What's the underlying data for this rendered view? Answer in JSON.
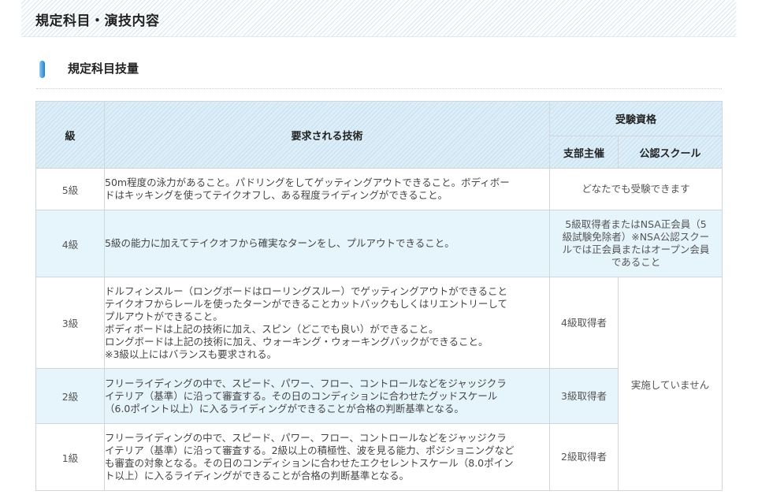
{
  "header": {
    "title": "規定科目・演技内容"
  },
  "section": {
    "title": "規定科目技量"
  },
  "table": {
    "headers": {
      "grade": "級",
      "technique": "要求される技術",
      "qualification": "受験資格",
      "branch": "支部主催",
      "school": "公認スクール"
    },
    "rows": [
      {
        "grade": "5級",
        "tech": [
          "50m程度の泳力があること。パドリングをしてゲッティングアウトできること。ボディボー",
          "ドはキッキングを使ってテイクオフし、ある程度ライディングができること。"
        ],
        "qualification": [
          "どなたでも受験できます"
        ]
      },
      {
        "grade": "4級",
        "tech": [
          "5級の能力に加えてテイクオフから確実なターンをし、プルアウトできること。"
        ],
        "qualification": [
          "5級取得者またはNSA正会員（5",
          "級試験免除者）※NSA公認スクー",
          "ルでは正会員またはオープン会員",
          "であること"
        ]
      },
      {
        "grade": "3級",
        "tech": [
          "ドルフィンスルー（ロングボードはローリングスルー）でゲッティングアウトができること",
          "テイクオフからレールを使ったターンができることカットバックもしくはリエントリーして",
          "プルアウトができること。",
          "ボディボードは上記の技術に加え、スピン（どこでも良い）ができること。",
          "ロングボードは上記の技術に加え、ウォーキング・ウォーキングバックができること。",
          "※3級以上にはバランスも要求される。"
        ],
        "branch": "4級取得者"
      },
      {
        "grade": "2級",
        "tech": [
          "フリーライディングの中で、スピード、パワー、フロー、コントロールなどをジャッジクラ",
          "イテリア（基準）に沿って審査する。その日のコンディションに合わせたグッドスケール",
          "（6.0ポイント以上）に入るライディングができることが合格の判断基準となる。"
        ],
        "branch": "3級取得者"
      },
      {
        "grade": "1級",
        "tech": [
          "フリーライディングの中で、スピード、パワー、フロー、コントロールなどをジャッジクラ",
          "イテリア（基準）に沿って審査する。2級以上の積極性、波を見る能力、ポジショニングなど",
          "も審査の対象となる。その日のコンディションに合わせたエクセレントスケール（8.0ポイン",
          "ト以上）に入るライディングができることが合格の判断基準となる。"
        ],
        "branch": "2級取得者"
      }
    ],
    "school_note": "実施していません"
  }
}
